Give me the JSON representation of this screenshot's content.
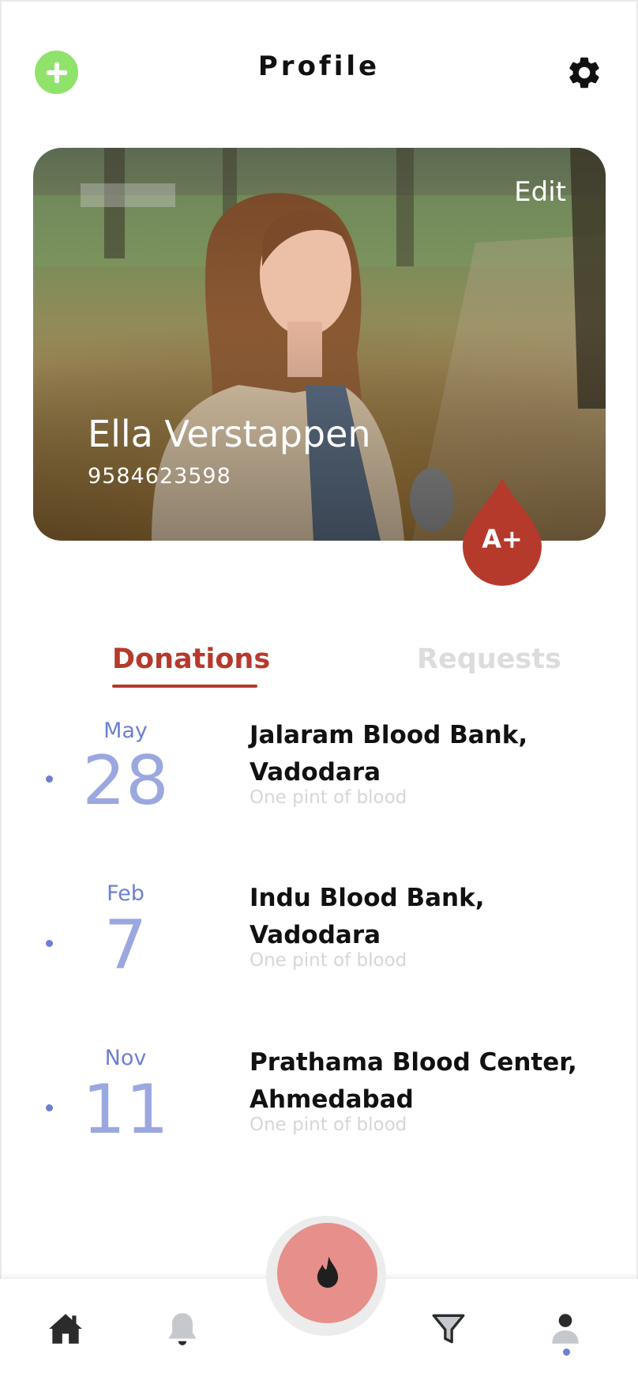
{
  "header": {
    "title": "Profile",
    "add_icon": "plus-icon",
    "settings_icon": "gear-icon"
  },
  "profile": {
    "edit_label": "Edit",
    "name": "Ella Verstappen",
    "phone": "9584623598",
    "blood_group": "A+"
  },
  "tabs": [
    {
      "label": "Donations",
      "active": true
    },
    {
      "label": "Requests",
      "active": false
    }
  ],
  "donations": [
    {
      "month": "May",
      "day": "28",
      "bank_line1": "Jalaram Blood Bank,",
      "bank_line2": "Vadodara",
      "amount": "One pint of blood"
    },
    {
      "month": "Feb",
      "day": "7",
      "bank_line1": "Indu Blood Bank,",
      "bank_line2": "Vadodara",
      "amount": "One pint of blood"
    },
    {
      "month": "Nov",
      "day": "11",
      "bank_line1": "Prathama Blood Center,",
      "bank_line2": "Ahmedabad",
      "amount": "One pint of blood"
    }
  ],
  "nav": {
    "items": [
      "home-icon",
      "bell-icon",
      "flame-icon",
      "filter-icon",
      "user-icon"
    ],
    "active": "user-icon"
  },
  "colors": {
    "accent_red": "#b53a2c",
    "accent_blue": "#6d7fd3",
    "add_green": "#8fe36a",
    "fab_pink": "#e78f8a"
  }
}
